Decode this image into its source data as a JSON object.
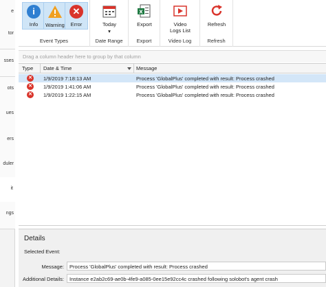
{
  "left_nav": {
    "items": [
      {
        "label": "e"
      },
      {
        "label": "tor"
      },
      {
        "label": "sses"
      },
      {
        "label": "ots"
      },
      {
        "label": "ues"
      },
      {
        "label": "ers"
      },
      {
        "label": "duler"
      },
      {
        "label": "it"
      },
      {
        "label": "ngs"
      }
    ]
  },
  "ribbon": {
    "event_types": {
      "group_label": "Event Types",
      "info_label": "Info",
      "warning_label": "Warning",
      "error_label": "Error"
    },
    "date_range": {
      "group_label": "Date Range",
      "today_label": "Today"
    },
    "export": {
      "group_label": "Export",
      "export_label": "Export"
    },
    "video_log": {
      "group_label": "Video Log",
      "video_logs_list_label_1": "Video",
      "video_logs_list_label_2": "Logs List"
    },
    "refresh": {
      "group_label": "Refresh",
      "refresh_label": "Refresh"
    }
  },
  "grid": {
    "group_hint": "Drag a column header here to group by that column",
    "columns": {
      "type": "Type",
      "datetime": "Date & Time",
      "message": "Message"
    },
    "rows": [
      {
        "datetime": "1/9/2019 7:18:13 AM",
        "message": "Process 'GlobalPlus' completed with result: Process crashed",
        "selected": true
      },
      {
        "datetime": "1/9/2019 1:41:06 AM",
        "message": "Process 'GlobalPlus' completed with result: Process crashed",
        "selected": false
      },
      {
        "datetime": "1/9/2019 1:22:15 AM",
        "message": "Process 'GlobalPlus' completed with result: Process crashed",
        "selected": false
      }
    ]
  },
  "details": {
    "title": "Details",
    "selected_event_label": "Selected Event:",
    "message_label": "Message:",
    "message_value": "Process 'GlobalPlus' completed with result: Process crashed",
    "additional_label": "Additional Details:",
    "additional_value": "Instance e2ab2c69-ae0b-4fe9-a085-0ee15e92cc4c crashed following solobot's agent crash"
  },
  "colors": {
    "info": "#2f7fd1",
    "warning": "#f0a022",
    "error": "#d9342b",
    "active_button": "#cfe5f7",
    "selected_row": "#d3e6f8"
  }
}
